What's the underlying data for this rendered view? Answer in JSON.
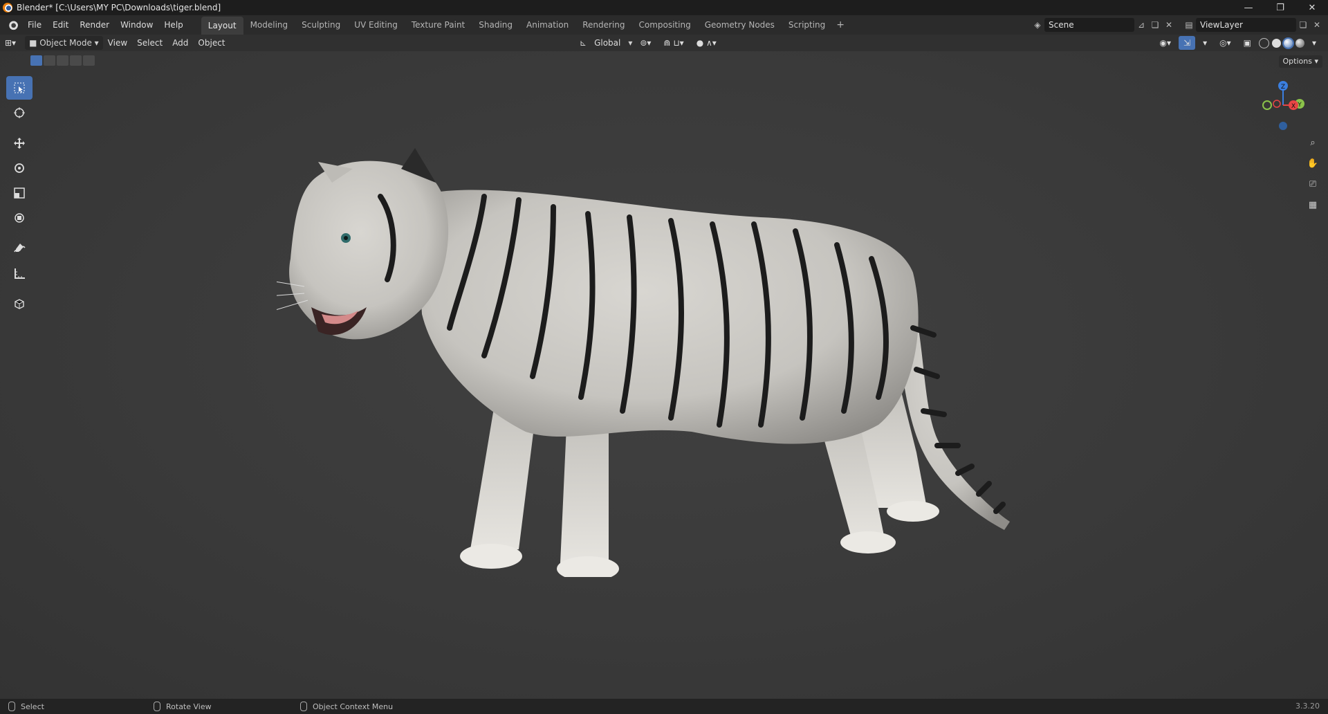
{
  "window": {
    "title": "Blender* [C:\\Users\\MY PC\\Downloads\\tiger.blend]",
    "controls": [
      "—",
      "❐",
      "✕"
    ]
  },
  "menu": [
    "File",
    "Edit",
    "Render",
    "Window",
    "Help"
  ],
  "workspaces": [
    "Layout",
    "Modeling",
    "Sculpting",
    "UV Editing",
    "Texture Paint",
    "Shading",
    "Animation",
    "Rendering",
    "Compositing",
    "Geometry Nodes",
    "Scripting"
  ],
  "active_workspace": "Layout",
  "scene": {
    "name": "Scene"
  },
  "view_layer": {
    "name": "ViewLayer"
  },
  "header": {
    "mode": "Object Mode",
    "view": "View",
    "select": "Select",
    "add": "Add",
    "object": "Object",
    "orientation": "Global",
    "options": "Options"
  },
  "gizmo": {
    "z": "Z",
    "y": "Y",
    "x": "X"
  },
  "tools": [
    "select-box-icon",
    "cursor-icon",
    "move-icon",
    "rotate-icon",
    "scale-icon",
    "transform-icon",
    "annotate-icon",
    "measure-icon",
    "add-cube-icon"
  ],
  "status": {
    "select": "Select",
    "rotate": "Rotate View",
    "context": "Object Context Menu",
    "version": "3.3.20"
  },
  "colors": {
    "accent": "#4772b3",
    "x_axis": "#e84545",
    "y_axis": "#8bc34a",
    "z_axis": "#3b7fe0"
  }
}
